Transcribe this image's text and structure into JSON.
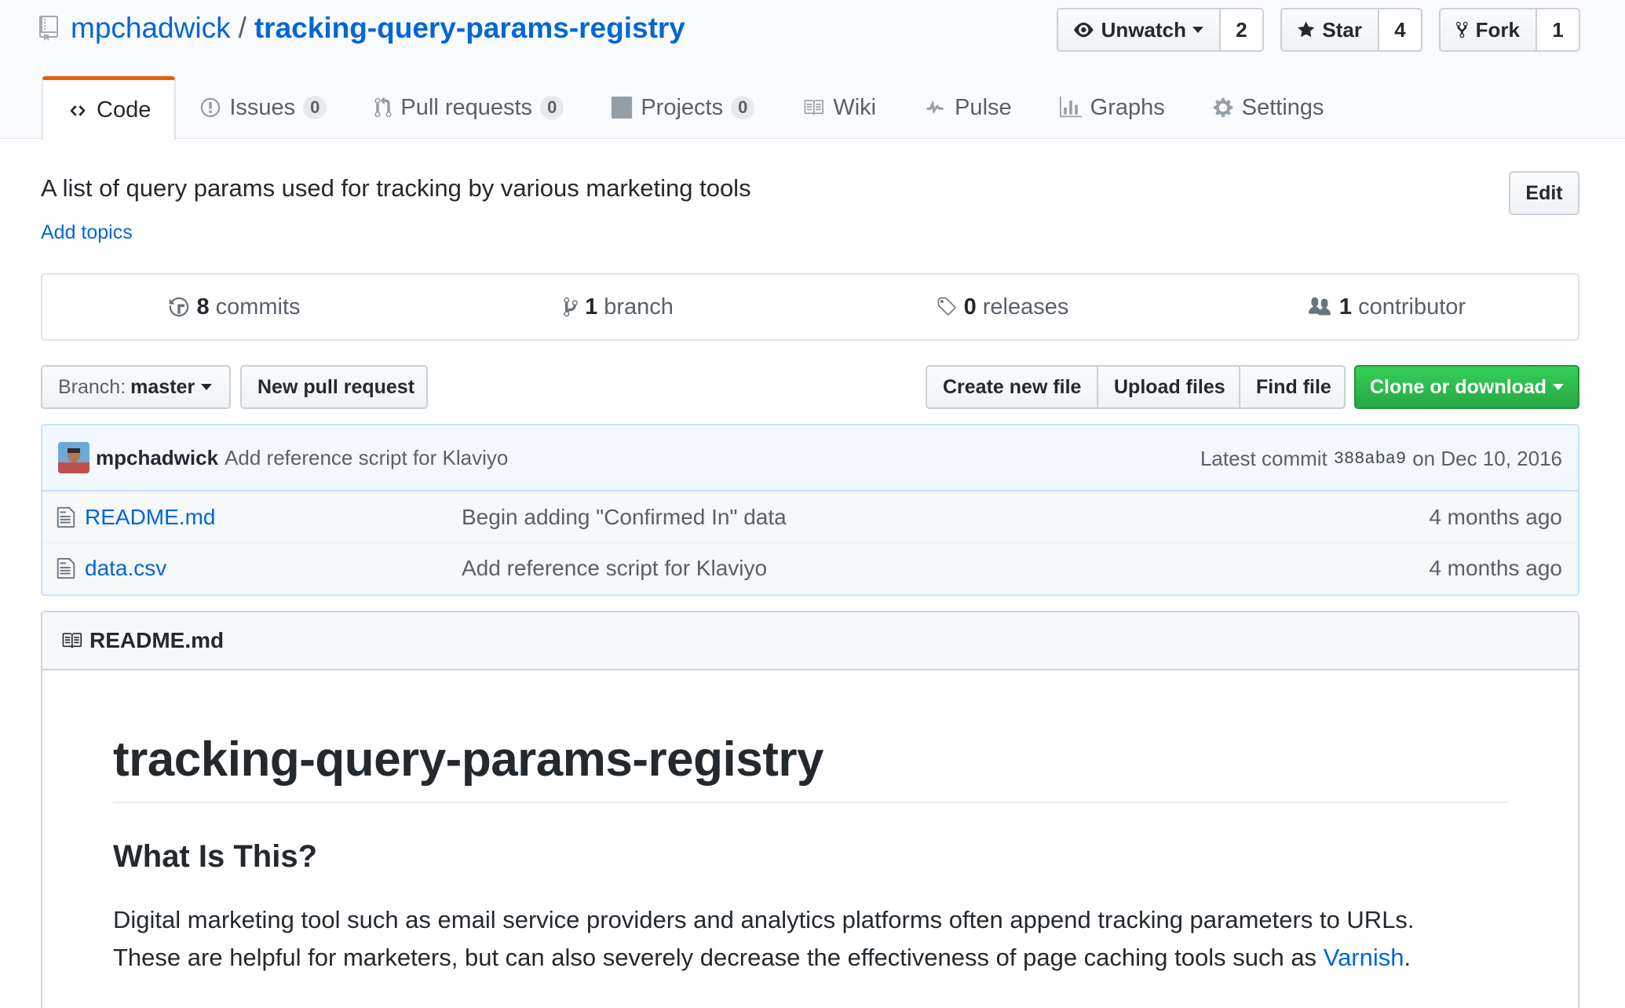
{
  "repo": {
    "owner": "mpchadwick",
    "separator": "/",
    "name": "tracking-query-params-registry"
  },
  "social": {
    "watch_label": "Unwatch",
    "watch_count": "2",
    "star_label": "Star",
    "star_count": "4",
    "fork_label": "Fork",
    "fork_count": "1"
  },
  "nav": {
    "code": "Code",
    "issues": "Issues",
    "issues_count": "0",
    "pulls": "Pull requests",
    "pulls_count": "0",
    "projects": "Projects",
    "projects_count": "0",
    "wiki": "Wiki",
    "pulse": "Pulse",
    "graphs": "Graphs",
    "settings": "Settings"
  },
  "description": "A list of query params used for tracking by various marketing tools",
  "add_topics": "Add topics",
  "edit_label": "Edit",
  "summary": {
    "commits_num": "8",
    "commits_label": "commits",
    "branches_num": "1",
    "branches_label": "branch",
    "releases_num": "0",
    "releases_label": "releases",
    "contributors_num": "1",
    "contributors_label": "contributor"
  },
  "toolbar": {
    "branch_label": "Branch:",
    "branch_value": "master",
    "new_pr": "New pull request",
    "create_file": "Create new file",
    "upload_files": "Upload files",
    "find_file": "Find file",
    "clone": "Clone or download"
  },
  "commit": {
    "author": "mpchadwick",
    "message": "Add reference script for Klaviyo",
    "latest_label": "Latest commit",
    "sha": "388aba9",
    "date": "on Dec 10, 2016"
  },
  "files": [
    {
      "name": "README.md",
      "message": "Begin adding \"Confirmed In\" data",
      "age": "4 months ago"
    },
    {
      "name": "data.csv",
      "message": "Add reference script for Klaviyo",
      "age": "4 months ago"
    }
  ],
  "readme": {
    "filename": "README.md",
    "h1": "tracking-query-params-registry",
    "h2": "What Is This?",
    "p_line1": "Digital marketing tool such as email service providers and analytics platforms often append tracking parameters to URLs.",
    "p_line2": "These are helpful for marketers, but can also severely decrease the effectiveness of page caching tools such as",
    "p_link": "Varnish",
    "p_end": "."
  },
  "colors": {
    "link": "#0366d6",
    "nav_selected_border": "#e36209",
    "clone_green": "#28a745",
    "commit_bg": "#f1f8ff"
  }
}
